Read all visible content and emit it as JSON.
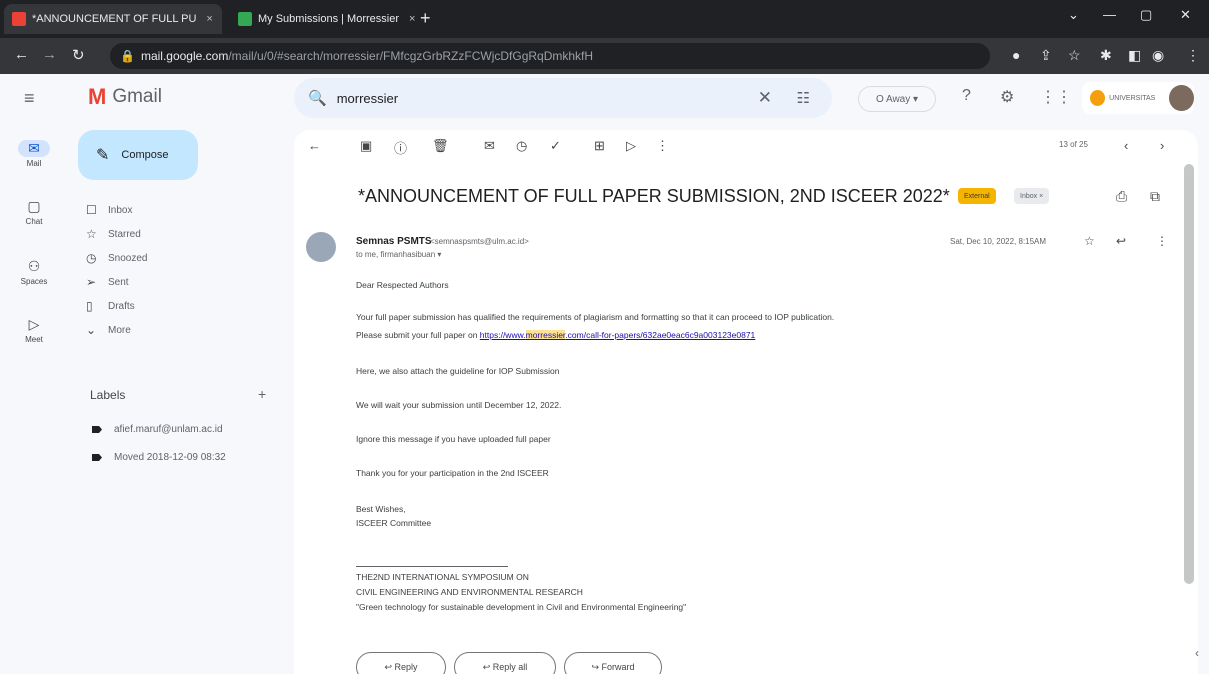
{
  "browser": {
    "tabs": [
      {
        "title": "*ANNOUNCEMENT OF FULL PU",
        "favicon_color": "#ea4335"
      },
      {
        "title": "My Submissions | Morressier",
        "favicon_color": "#34a853"
      }
    ],
    "close_glyph": "×",
    "new_tab_glyph": "+",
    "url_host": "mail.google.com",
    "url_path": "/mail/u/0/#search/morressier/FMfcgzGrbRZzFCWjcDfGgRqDmkhkfH",
    "window_controls": [
      "⌄",
      "—",
      "▢",
      "✕"
    ]
  },
  "gmail": {
    "app_name": "Gmail",
    "search_query": "morressier",
    "status": "O Away ▾",
    "account_org": "UNIVERSITAS"
  },
  "rail": [
    {
      "label": "Mail",
      "icon": "mail-icon",
      "glyph": "✉"
    },
    {
      "label": "Chat",
      "icon": "chat-icon",
      "glyph": "▢"
    },
    {
      "label": "Spaces",
      "icon": "spaces-icon",
      "glyph": "⚇"
    },
    {
      "label": "Meet",
      "icon": "meet-icon",
      "glyph": "▷"
    }
  ],
  "nav": {
    "compose": "Compose",
    "items": [
      {
        "label": "Inbox",
        "glyph": "☐"
      },
      {
        "label": "Starred",
        "glyph": "☆"
      },
      {
        "label": "Snoozed",
        "glyph": "◷"
      },
      {
        "label": "Sent",
        "glyph": "➢"
      },
      {
        "label": "Drafts",
        "glyph": "▯"
      },
      {
        "label": "More",
        "glyph": "⌄"
      }
    ],
    "labels_title": "Labels",
    "labels": [
      "afief.maruf@unlam.ac.id",
      "Moved 2018-12-09 08:32"
    ]
  },
  "email": {
    "pager": "13 of 25",
    "subject": "*ANNOUNCEMENT OF FULL PAPER SUBMISSION, 2ND ISCEER 2022*",
    "tag_external": "External",
    "tag_inbox": "Inbox ×",
    "sender_name": "Semnas PSMTS",
    "sender_email": "<semnaspsmts@ulm.ac.id>",
    "to": "to me, firmanhasibuan ▾",
    "date": "Sat, Dec 10, 2022, 8:15AM",
    "greeting": "Dear Respected Authors",
    "line1": "Your full paper submission has qualified the requirements of plagiarism and formatting so that it can proceed to IOP publication.",
    "line2_prefix": "Please submit your full paper on ",
    "link_pre": "https://www.",
    "link_hl": "morressier",
    "link_post": ".com/call-for-papers/632ae0eac6c9a003123e0871",
    "line3": "Here, we also attach the guideline for IOP Submission",
    "line4": "We will wait your submission until December 12, 2022.",
    "line5": "Ignore this message if you have uploaded full paper",
    "line6": "Thank you for your participation in the 2nd ISCEER",
    "sign1": "Best Wishes,",
    "sign2": "ISCEER Committee",
    "sig_a": "THE2ND INTERNATIONAL SYMPOSIUM ON",
    "sig_b": "CIVIL ENGINEERING AND ENVIRONMENTAL RESEARCH",
    "sig_c": "\"Green technology for sustainable development in Civil and Environmental Engineering\"",
    "reply_buttons": [
      "↩ Reply",
      "↩ Reply all",
      "↪ Forward"
    ]
  }
}
